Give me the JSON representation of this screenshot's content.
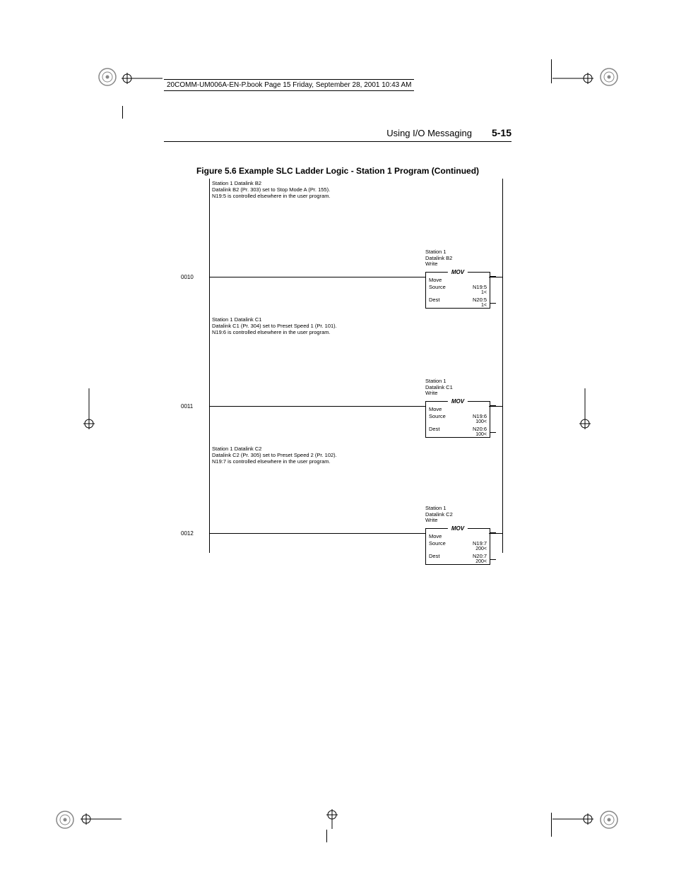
{
  "header_line": "20COMM-UM006A-EN-P.book  Page 15  Friday, September 28, 2001  10:43 AM",
  "running_head": {
    "chapter": "Using I/O Messaging",
    "pagenum": "5-15"
  },
  "figure_caption": "Figure 5.6   Example SLC Ladder Logic - Station 1 Program (Continued)",
  "rungs": [
    {
      "num": "0010",
      "comment": "Station 1 Datalink B2\nDatalink B2 (Pr. 303) set to Stop Mode A (Pr. 155).\nN19:5 is controlled elsewhere in the user program.",
      "boxlabel": "Station 1\nDatalink B2\nWrite",
      "mov": {
        "title": "MOV",
        "r1": "Move",
        "r2l": "Source",
        "r2r": "N19:5",
        "r2s": "1<",
        "r3l": "Dest",
        "r3r": "N20:5",
        "r3s": "1<"
      }
    },
    {
      "num": "0011",
      "comment": "Station 1 Datalink C1\nDatalink C1 (Pr. 304) set to Preset Speed 1 (Pr. 101).\nN19:6 is controlled elsewhere in the user program.",
      "boxlabel": "Station 1\nDatalink C1\nWrite",
      "mov": {
        "title": "MOV",
        "r1": "Move",
        "r2l": "Source",
        "r2r": "N19:6",
        "r2s": "100<",
        "r3l": "Dest",
        "r3r": "N20:6",
        "r3s": "100<"
      }
    },
    {
      "num": "0012",
      "comment": "Station 1 Datalink C2\nDatalink C2 (Pr. 305) set to Preset Speed 2 (Pr. 102).\nN19:7 is controlled elsewhere in the user program.",
      "boxlabel": "Station 1\nDatalink C2\nWrite",
      "mov": {
        "title": "MOV",
        "r1": "Move",
        "r2l": "Source",
        "r2r": "N19:7",
        "r2s": "200<",
        "r3l": "Dest",
        "r3r": "N20:7",
        "r3s": "200<"
      }
    }
  ]
}
